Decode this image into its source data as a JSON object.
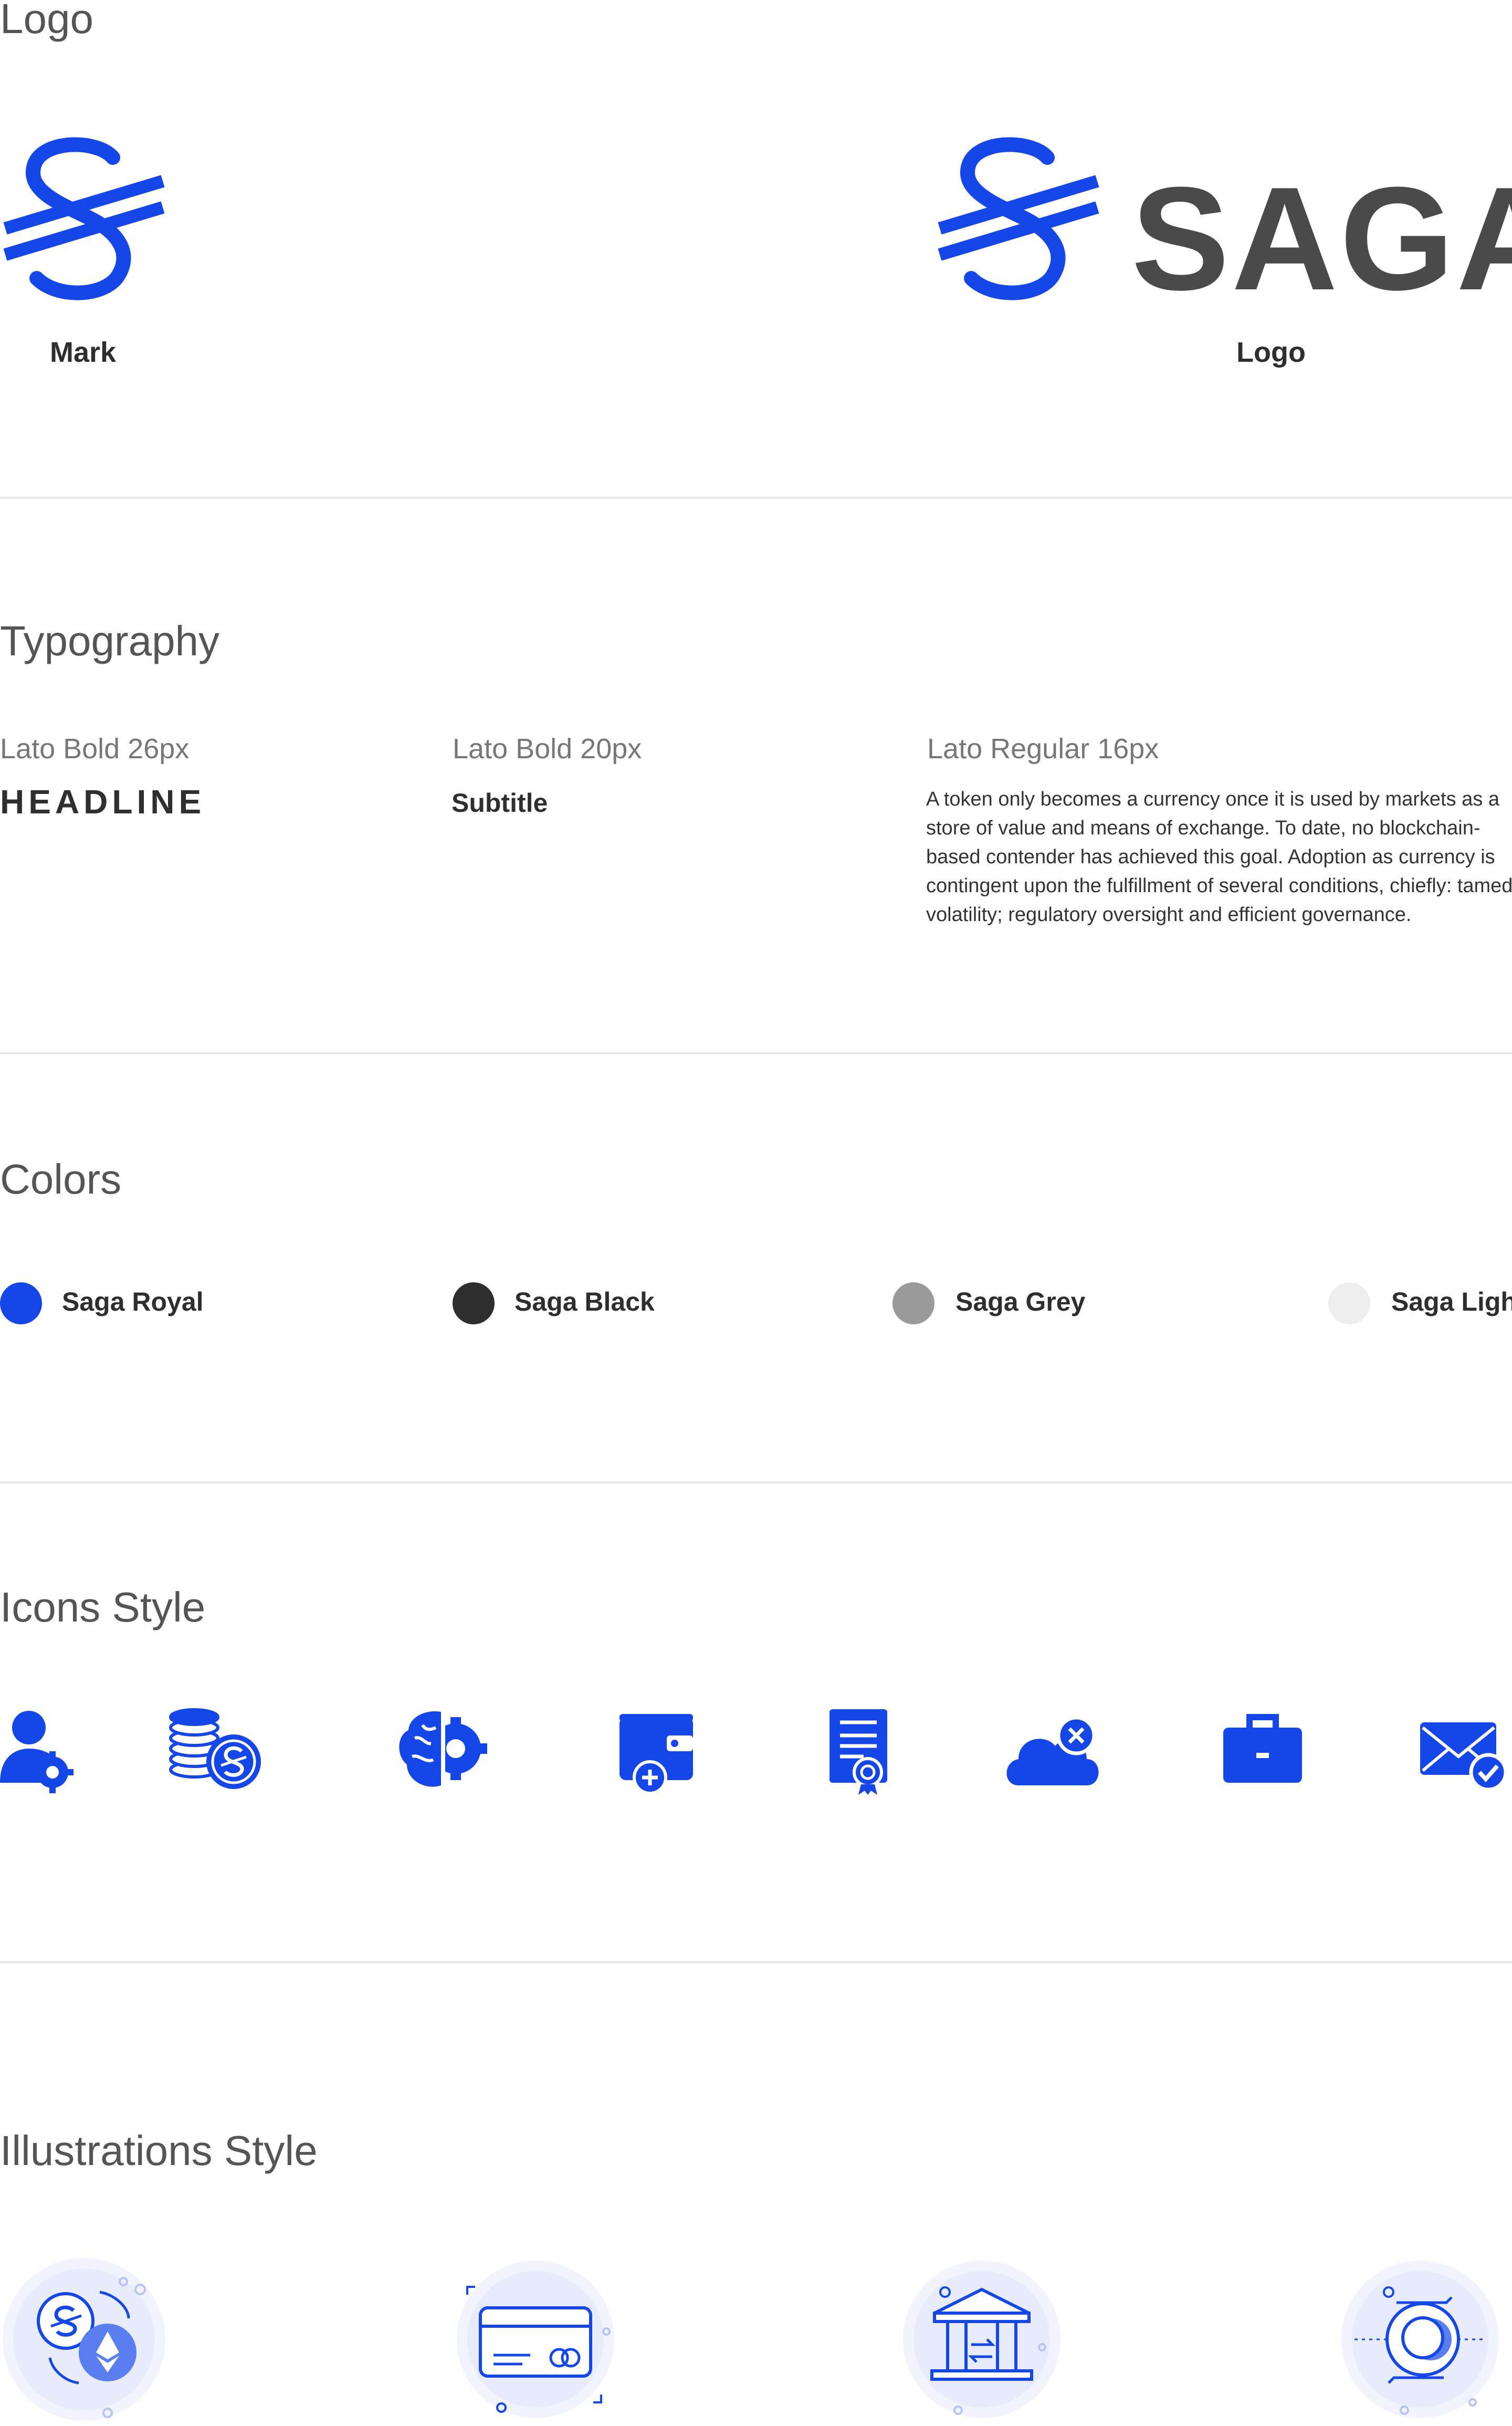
{
  "colors": {
    "royal": "#1446e8",
    "black": "#2e2e2e",
    "grey": "#9a9a9a",
    "light": "#eeeeee"
  },
  "logo": {
    "title": "Logo",
    "mark_caption": "Mark",
    "logo_caption": "Logo",
    "wordmark": "SAGA"
  },
  "typography": {
    "title": "Typography",
    "col1_label": "Lato Bold 26px",
    "col1_sample": "HEADLINE",
    "col2_label": "Lato Bold 20px",
    "col2_sample": "Subtitle",
    "col3_label": "Lato Regular 16px",
    "col3_sample": "A token only becomes a currency once it is used by markets as a store of value and means of exchange. To date, no blockchain-based contender has achieved this goal. Adoption as currency is contingent upon the fulfillment of several conditions, chiefly: tamed volatility; regulatory oversight and efficient governance."
  },
  "colors_section": {
    "title": "Colors",
    "swatches": [
      {
        "name": "Saga Royal",
        "color": "#1446e8"
      },
      {
        "name": "Saga Black",
        "color": "#2e2e2e"
      },
      {
        "name": "Saga Grey",
        "color": "#9a9a9a"
      },
      {
        "name": "Saga Light",
        "color": "#eeeeee"
      }
    ]
  },
  "icons": {
    "title": "Icons Style",
    "items": [
      "user-gear-icon",
      "coins-saga-icon",
      "brain-gear-icon",
      "wallet-add-icon",
      "certificate-icon",
      "cloud-remove-icon",
      "briefcase-icon",
      "mail-check-icon"
    ]
  },
  "illustrations": {
    "title": "Illustrations Style",
    "items": [
      "saga-ethereum-exchange-illustration",
      "credit-card-illustration",
      "bank-transfer-illustration",
      "saga-cycle-illustration"
    ]
  }
}
